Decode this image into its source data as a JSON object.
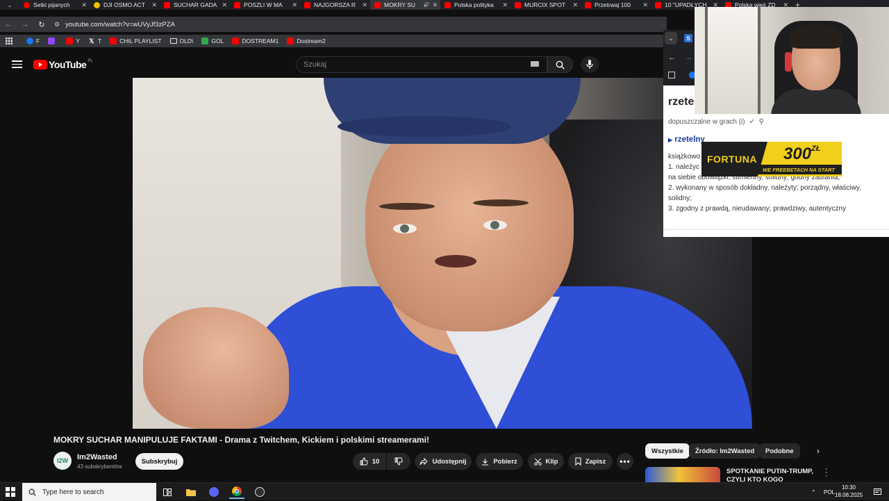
{
  "browser": {
    "tabs": [
      {
        "label": "Setki pijanych",
        "icon": "stream-favicon",
        "active": false
      },
      {
        "label": "DJI OSMO ACT",
        "icon": "dji-favicon",
        "active": false
      },
      {
        "label": "SUCHAR GADA",
        "icon": "youtube-favicon",
        "active": false
      },
      {
        "label": "POSZLI W MA",
        "icon": "youtube-favicon",
        "active": false
      },
      {
        "label": "NAJGORSZA R",
        "icon": "youtube-favicon",
        "active": false
      },
      {
        "label": "MOKRY SU",
        "icon": "youtube-favicon",
        "active": true
      },
      {
        "label": "Polska polityka",
        "icon": "youtube-favicon",
        "active": false
      },
      {
        "label": "MURCIX SPOT",
        "icon": "youtube-favicon",
        "active": false
      },
      {
        "label": "Przetrwaj 100",
        "icon": "youtube-favicon",
        "active": false
      },
      {
        "label": "10 \"UPADŁYCH",
        "icon": "youtube-favicon",
        "active": false
      },
      {
        "label": "Polska wieś ZD",
        "icon": "youtube-favicon",
        "active": false
      }
    ],
    "url": "youtube.com/watch?v=wUVyJf3zPZA",
    "bookmarks": [
      {
        "label": "F",
        "icon": "facebook-icon",
        "color": "#1877f2"
      },
      {
        "label": "",
        "icon": "twitch-icon",
        "color": "#9146ff"
      },
      {
        "label": "Y",
        "icon": "youtube-icon",
        "color": "#ff0000"
      },
      {
        "label": "T",
        "icon": "x-icon",
        "color": "#ffffff"
      },
      {
        "label": "CHIL PLAYLIST",
        "icon": "youtube-icon",
        "color": "#ff0000"
      },
      {
        "label": "OLD\\",
        "icon": "folder-icon",
        "color": "#e8eaed"
      },
      {
        "label": "GOL",
        "icon": "gol-icon",
        "color": "#2fa84f"
      },
      {
        "label": "DOSTREAM1",
        "icon": "youtube-icon",
        "color": "#ff0000"
      },
      {
        "label": "Dostream2",
        "icon": "youtube-icon",
        "color": "#ff0000"
      }
    ]
  },
  "youtube": {
    "logo_text": "YouTube",
    "logo_country": "PL",
    "search_placeholder": "Szukaj",
    "video_title": "MOKRY SUCHAR MANIPULUJE FAKTAMI - Drama z Twitchem, Kickiem i polskimi streamerami!",
    "channel": {
      "name": "Im2Wasted",
      "subscribers": "43 subskrybentów",
      "avatar_text": "I2W"
    },
    "subscribe_label": "Subskrybuj",
    "actions": {
      "likes": "10",
      "share": "Udostępnij",
      "download": "Pobierz",
      "clip": "Klip",
      "save": "Zapisz"
    },
    "chips": [
      "Wszystkie",
      "Źródło: Im2Wasted",
      "Podobne"
    ],
    "recommended": {
      "title_line1": "SPOTKANIE PUTIN-TRUMP,",
      "title_line2": "CZYLI KTO KOGO POZEGRAŁ?"
    }
  },
  "overlay": {
    "word": "rzete",
    "allowed": "dopuszczalne w grach (i)",
    "sense": "rzetelny",
    "lines": [
      "książkowo",
      "1. należyc                                                                      ujący przyjęte",
      "na siebie obowiązki; sumienny, solidny; godny zaufania;",
      "2. wykonany w sposób dokładny, należyty; porządny, właściwy,",
      "solidny;",
      "3. zgodny z prawdą, nieudawany; prawdziwy, autentyczny"
    ]
  },
  "ad": {
    "brand": "FORTUNA",
    "amount": "300",
    "currency": "ZŁ",
    "tagline": "WE FREEBETACH NA START"
  },
  "taskbar": {
    "search_placeholder": "Type here to search",
    "language": "POL",
    "time": "10:30",
    "date": "18.08.2025"
  }
}
